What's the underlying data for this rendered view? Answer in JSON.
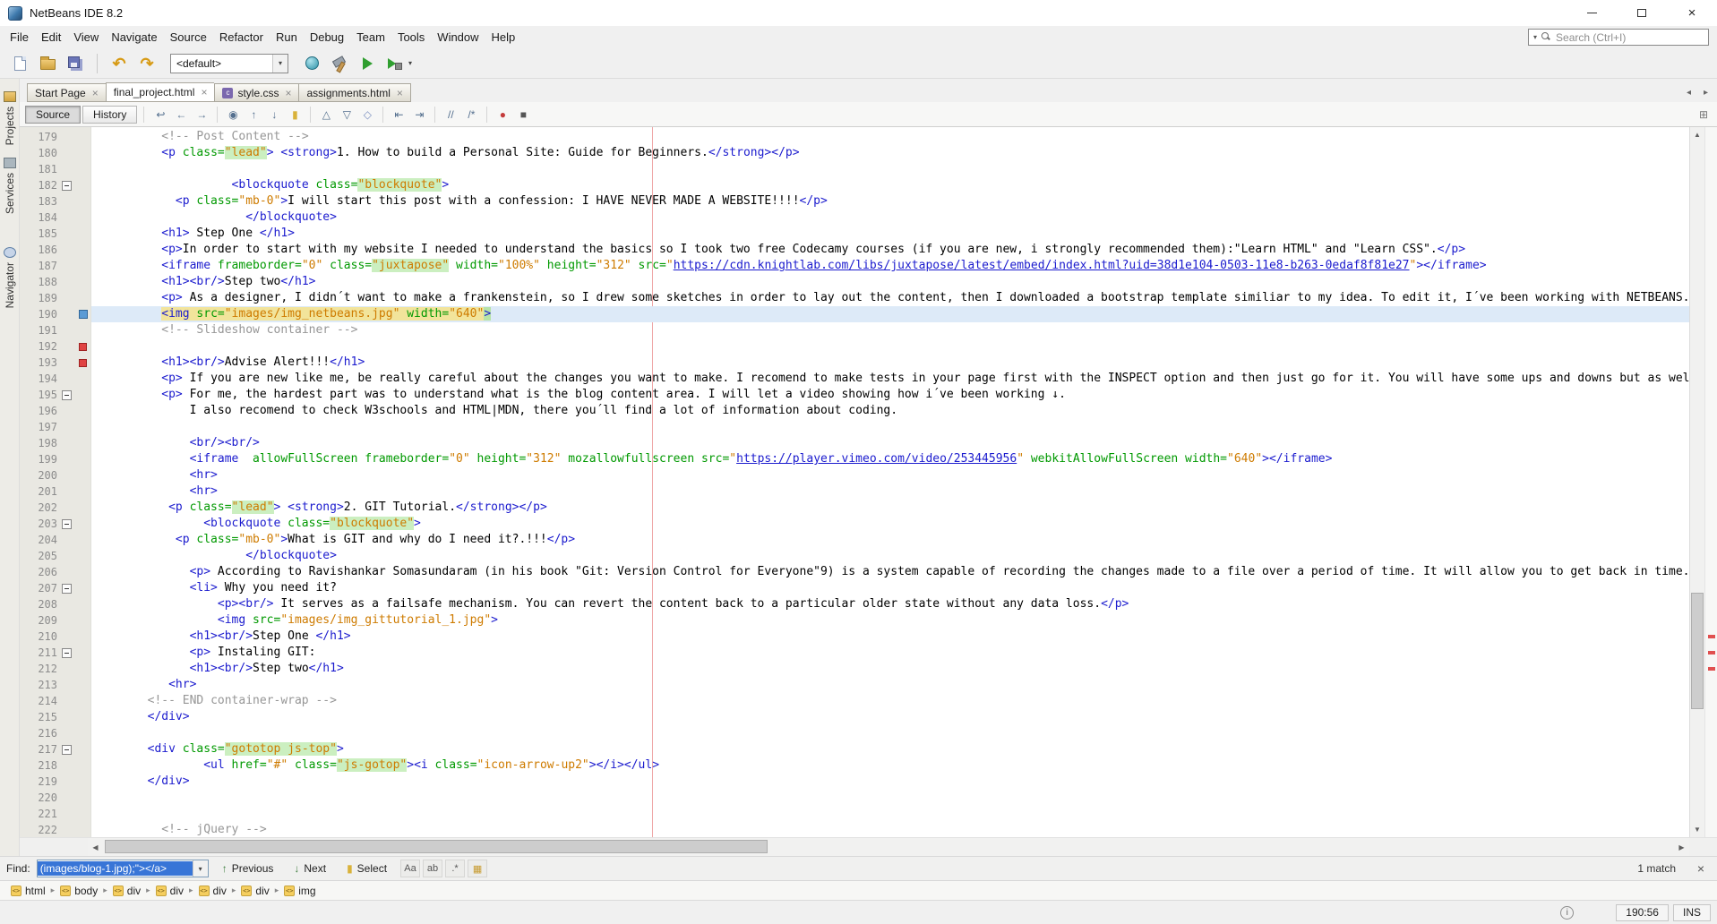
{
  "window": {
    "title": "NetBeans IDE 8.2"
  },
  "menu": {
    "items": [
      "File",
      "Edit",
      "View",
      "Navigate",
      "Source",
      "Refactor",
      "Run",
      "Debug",
      "Team",
      "Tools",
      "Window",
      "Help"
    ],
    "search_placeholder": "Search (Ctrl+I)"
  },
  "toolbar": {
    "config_value": "<default>",
    "icons": [
      "new-file",
      "open-project",
      "save-all",
      "undo",
      "redo",
      "clean-and-build",
      "build-project",
      "run-project",
      "debug-project"
    ]
  },
  "tabs": [
    {
      "label": "Start Page",
      "active": false
    },
    {
      "label": "final_project.html",
      "active": true
    },
    {
      "label": "style.css",
      "active": false,
      "icon": "css"
    },
    {
      "label": "assignments.html",
      "active": false
    }
  ],
  "sidebar": {
    "tabs": [
      {
        "label": "Projects",
        "icon": "projects"
      },
      {
        "label": "Services",
        "icon": "services"
      },
      {
        "label": "Navigator",
        "icon": "navigator"
      }
    ]
  },
  "editor_toolbar": {
    "source_label": "Source",
    "history_label": "History",
    "icons": [
      {
        "name": "last-edit-icon",
        "glyph": "↩"
      },
      {
        "name": "back-icon",
        "glyph": "←"
      },
      {
        "name": "forward-icon",
        "glyph": "→"
      },
      {
        "sep": true
      },
      {
        "name": "find-selection-icon",
        "glyph": "◉"
      },
      {
        "name": "find-previous-icon",
        "glyph": "↑"
      },
      {
        "name": "find-next-icon",
        "glyph": "↓"
      },
      {
        "name": "toggle-highlight-icon",
        "glyph": "▮",
        "color": "#D9B23A"
      },
      {
        "sep": true
      },
      {
        "name": "previous-bookmark-icon",
        "glyph": "△"
      },
      {
        "name": "next-bookmark-icon",
        "glyph": "▽"
      },
      {
        "name": "toggle-bookmark-icon",
        "glyph": "◇",
        "color": "#7A8FC0"
      },
      {
        "sep": true
      },
      {
        "name": "shift-left-icon",
        "glyph": "⇤"
      },
      {
        "name": "shift-right-icon",
        "glyph": "⇥"
      },
      {
        "sep": true
      },
      {
        "name": "comment-icon",
        "glyph": "//"
      },
      {
        "name": "uncomment-icon",
        "glyph": "/*"
      },
      {
        "sep": true
      },
      {
        "name": "start-macro-icon",
        "glyph": "●",
        "color": "#C43B3B"
      },
      {
        "name": "stop-macro-icon",
        "glyph": "■",
        "color": "#555555"
      }
    ]
  },
  "editor": {
    "first_line": 179,
    "current_line": 190,
    "fold_lines": [
      182,
      195,
      203,
      207,
      211,
      217
    ],
    "error_lines": [
      192,
      193
    ],
    "error_stripe": [
      0.715,
      0.738,
      0.76
    ],
    "lines": [
      {
        "i": 10,
        "t": [
          [
            "com",
            "<!-- Post Content -->"
          ]
        ]
      },
      {
        "i": 10,
        "t": [
          [
            "tag",
            "<p"
          ],
          [
            "attr",
            " class="
          ],
          [
            "valh",
            "\"lead\""
          ],
          [
            "tag",
            ">"
          ],
          [
            "txt",
            " "
          ],
          [
            "tag",
            "<strong>"
          ],
          [
            "txt",
            "1. How to build a Personal Site: Guide for Beginners."
          ],
          [
            "tag",
            "</strong></p>"
          ]
        ]
      },
      {
        "i": 0,
        "t": []
      },
      {
        "i": 20,
        "t": [
          [
            "tag",
            "<blockquote"
          ],
          [
            "attr",
            " class="
          ],
          [
            "valh",
            "\"blockquote\""
          ],
          [
            "tag",
            ">"
          ]
        ]
      },
      {
        "i": 12,
        "t": [
          [
            "tag",
            "<p"
          ],
          [
            "attr",
            " class="
          ],
          [
            "val",
            "\"mb-0\""
          ],
          [
            "tag",
            ">"
          ],
          [
            "txt",
            "I will start this post with a confession: I HAVE NEVER MADE A WEBSITE!!!!"
          ],
          [
            "tag",
            "</p>"
          ]
        ]
      },
      {
        "i": 22,
        "t": [
          [
            "tag",
            "</blockquote>"
          ]
        ]
      },
      {
        "i": 10,
        "t": [
          [
            "tag",
            "<h1>"
          ],
          [
            "txt",
            " Step One "
          ],
          [
            "tag",
            "</h1>"
          ]
        ]
      },
      {
        "i": 10,
        "t": [
          [
            "tag",
            "<p>"
          ],
          [
            "txt",
            "In order to start with my website I needed to understand the basics so I took two free Codecamy courses (if you are new, i strongly recommended them):\"Learn HTML\" and \"Learn CSS\"."
          ],
          [
            "tag",
            "</p>"
          ]
        ]
      },
      {
        "i": 10,
        "t": [
          [
            "tag",
            "<iframe"
          ],
          [
            "attr",
            " frameborder="
          ],
          [
            "val",
            "\"0\""
          ],
          [
            "attr",
            " class="
          ],
          [
            "valh",
            "\"juxtapose\""
          ],
          [
            "attr",
            " width="
          ],
          [
            "val",
            "\"100%\""
          ],
          [
            "attr",
            " height="
          ],
          [
            "val",
            "\"312\""
          ],
          [
            "attr",
            " src="
          ],
          [
            "val",
            "\""
          ],
          [
            "link",
            "https://cdn.knightlab.com/libs/juxtapose/latest/embed/index.html?uid=38d1e104-0503-11e8-b263-0edaf8f81e27"
          ],
          [
            "val",
            "\""
          ],
          [
            "tag",
            "></iframe>"
          ]
        ]
      },
      {
        "i": 10,
        "t": [
          [
            "tag",
            "<h1><br/>"
          ],
          [
            "txt",
            "Step two"
          ],
          [
            "tag",
            "</h1>"
          ]
        ]
      },
      {
        "i": 10,
        "t": [
          [
            "tag",
            "<p>"
          ],
          [
            "txt",
            " As a designer, I didn´t want to make a frankenstein, so I drew some sketches in order to lay out the content, then I downloaded a bootstrap template similiar to my idea. To edit it, I´ve been working with NETBEANS."
          ]
        ]
      },
      {
        "i": 10,
        "t": [
          [
            "tagy",
            "<img"
          ],
          [
            "attry",
            " src="
          ],
          [
            "valy",
            "\"images/img_netbeans.jpg\""
          ],
          [
            "attry",
            " width="
          ],
          [
            "valy",
            "\"640\""
          ],
          [
            "tagg",
            ">"
          ]
        ]
      },
      {
        "i": 10,
        "t": [
          [
            "com",
            "<!-- Slideshow container -->"
          ]
        ]
      },
      {
        "i": 0,
        "t": []
      },
      {
        "i": 10,
        "t": [
          [
            "tag",
            "<h1><br/>"
          ],
          [
            "txt",
            "Advise Alert!!!"
          ],
          [
            "tag",
            "</h1>"
          ]
        ]
      },
      {
        "i": 10,
        "t": [
          [
            "tag",
            "<p>"
          ],
          [
            "txt",
            " If you are new like me, be really careful about the changes you want to make. I recomend to make tests in your page first with the INSPECT option and then just go for it. You will have some ups and downs but as well."
          ]
        ]
      },
      {
        "i": 10,
        "t": [
          [
            "tag",
            "<p>"
          ],
          [
            "txt",
            " For me, the hardest part was to understand what is the blog content area. I will let a video showing how i´ve been working ↓."
          ]
        ]
      },
      {
        "i": 14,
        "t": [
          [
            "txt",
            "I also recomend to check W3schools and HTML|MDN, there you´ll find a lot of information about coding."
          ]
        ]
      },
      {
        "i": 0,
        "t": []
      },
      {
        "i": 14,
        "t": [
          [
            "tag",
            "<br/><br/>"
          ]
        ]
      },
      {
        "i": 14,
        "t": [
          [
            "tag",
            "<iframe"
          ],
          [
            "attr",
            "  allowFullScreen"
          ],
          [
            "attr",
            " frameborder="
          ],
          [
            "val",
            "\"0\""
          ],
          [
            "attr",
            " height="
          ],
          [
            "val",
            "\"312\""
          ],
          [
            "attr",
            " mozallowfullscreen"
          ],
          [
            "attr",
            " src="
          ],
          [
            "val",
            "\""
          ],
          [
            "link",
            "https://player.vimeo.com/video/253445956"
          ],
          [
            "val",
            "\""
          ],
          [
            "attr",
            " webkitAllowFullScreen"
          ],
          [
            "attr",
            " width="
          ],
          [
            "val",
            "\"640\""
          ],
          [
            "tag",
            "></iframe>"
          ]
        ]
      },
      {
        "i": 14,
        "t": [
          [
            "tag",
            "<hr>"
          ]
        ]
      },
      {
        "i": 14,
        "t": [
          [
            "tag",
            "<hr>"
          ]
        ]
      },
      {
        "i": 11,
        "t": [
          [
            "tag",
            "<p"
          ],
          [
            "attr",
            " class="
          ],
          [
            "valh",
            "\"lead\""
          ],
          [
            "tag",
            ">"
          ],
          [
            "txt",
            " "
          ],
          [
            "tag",
            "<strong>"
          ],
          [
            "txt",
            "2. GIT Tutorial."
          ],
          [
            "tag",
            "</strong></p>"
          ]
        ]
      },
      {
        "i": 16,
        "t": [
          [
            "tag",
            "<blockquote"
          ],
          [
            "attr",
            " class="
          ],
          [
            "valh",
            "\"blockquote\""
          ],
          [
            "tag",
            ">"
          ]
        ]
      },
      {
        "i": 12,
        "t": [
          [
            "tag",
            "<p"
          ],
          [
            "attr",
            " class="
          ],
          [
            "val",
            "\"mb-0\""
          ],
          [
            "tag",
            ">"
          ],
          [
            "txt",
            "What is GIT and why do I need it?.!!!"
          ],
          [
            "tag",
            "</p>"
          ]
        ]
      },
      {
        "i": 22,
        "t": [
          [
            "tag",
            "</blockquote>"
          ]
        ]
      },
      {
        "i": 14,
        "t": [
          [
            "tag",
            "<p>"
          ],
          [
            "txt",
            " According to Ravishankar Somasundaram (in his book \"Git: Version Control for Everyone\"9) is a system capable of recording the changes made to a file over a period of time. It will allow you to get back in time."
          ]
        ]
      },
      {
        "i": 14,
        "t": [
          [
            "tag",
            "<li>"
          ],
          [
            "txt",
            " Why you need it?"
          ]
        ]
      },
      {
        "i": 18,
        "t": [
          [
            "tag",
            "<p><br/>"
          ],
          [
            "txt",
            " It serves as a failsafe mechanism. You can revert the content back to a particular older state without any data loss."
          ],
          [
            "tag",
            "</p>"
          ]
        ]
      },
      {
        "i": 18,
        "t": [
          [
            "tag",
            "<img"
          ],
          [
            "attr",
            " src="
          ],
          [
            "val",
            "\"images/img_gittutorial_1.jpg\""
          ],
          [
            "tag",
            ">"
          ]
        ]
      },
      {
        "i": 14,
        "t": [
          [
            "tag",
            "<h1><br/>"
          ],
          [
            "txt",
            "Step One "
          ],
          [
            "tag",
            "</h1>"
          ]
        ]
      },
      {
        "i": 14,
        "t": [
          [
            "tag",
            "<p>"
          ],
          [
            "txt",
            " Instaling GIT:"
          ]
        ]
      },
      {
        "i": 14,
        "t": [
          [
            "tag",
            "<h1><br/>"
          ],
          [
            "txt",
            "Step two"
          ],
          [
            "tag",
            "</h1>"
          ]
        ]
      },
      {
        "i": 11,
        "t": [
          [
            "tag",
            "<hr>"
          ]
        ]
      },
      {
        "i": 8,
        "t": [
          [
            "com",
            "<!-- END container-wrap -->"
          ]
        ]
      },
      {
        "i": 8,
        "t": [
          [
            "tag",
            "</div>"
          ]
        ]
      },
      {
        "i": 0,
        "t": []
      },
      {
        "i": 8,
        "t": [
          [
            "tag",
            "<div"
          ],
          [
            "attr",
            " class="
          ],
          [
            "valh",
            "\"gototop js-top\""
          ],
          [
            "tag",
            ">"
          ]
        ]
      },
      {
        "i": 16,
        "t": [
          [
            "tag",
            "<ul"
          ],
          [
            "attr",
            " href="
          ],
          [
            "val",
            "\"#\""
          ],
          [
            "attr",
            " class="
          ],
          [
            "valh",
            "\"js-gotop\""
          ],
          [
            "tag",
            "><i"
          ],
          [
            "attr",
            " class="
          ],
          [
            "val",
            "\"icon-arrow-up2\""
          ],
          [
            "tag",
            "></i></ul>"
          ]
        ]
      },
      {
        "i": 8,
        "t": [
          [
            "tag",
            "</div>"
          ]
        ]
      },
      {
        "i": 0,
        "t": []
      },
      {
        "i": 0,
        "t": []
      },
      {
        "i": 10,
        "t": [
          [
            "com",
            "<!-- jQuery -->"
          ]
        ]
      }
    ]
  },
  "find_bar": {
    "label": "Find:",
    "value": "(images/blog-1.jpg);\"></a>",
    "previous": "Previous",
    "next": "Next",
    "select": "Select",
    "matches": "1 match",
    "toggles": [
      {
        "name": "match-case-toggle",
        "glyph": "Aa"
      },
      {
        "name": "whole-words-toggle",
        "glyph": "ab"
      },
      {
        "name": "regex-toggle",
        "glyph": ".*"
      },
      {
        "name": "highlight-results-toggle",
        "glyph": "▦",
        "color": "#C79A2E"
      }
    ]
  },
  "breadcrumb": [
    "html",
    "body",
    "div",
    "div",
    "div",
    "div",
    "img"
  ],
  "status": {
    "position": "190:56",
    "mode": "INS"
  },
  "colors": {
    "tag": "#1B1BCE",
    "attribute": "#009900",
    "value": "#CE7B00",
    "comment": "#969696",
    "occurrence_highlight": "#CBEFC0",
    "match_highlight": "#F2E49B",
    "current_line": "#DDEAF8",
    "selection": "#3875D7",
    "margin_line": "#EFA8A8"
  }
}
